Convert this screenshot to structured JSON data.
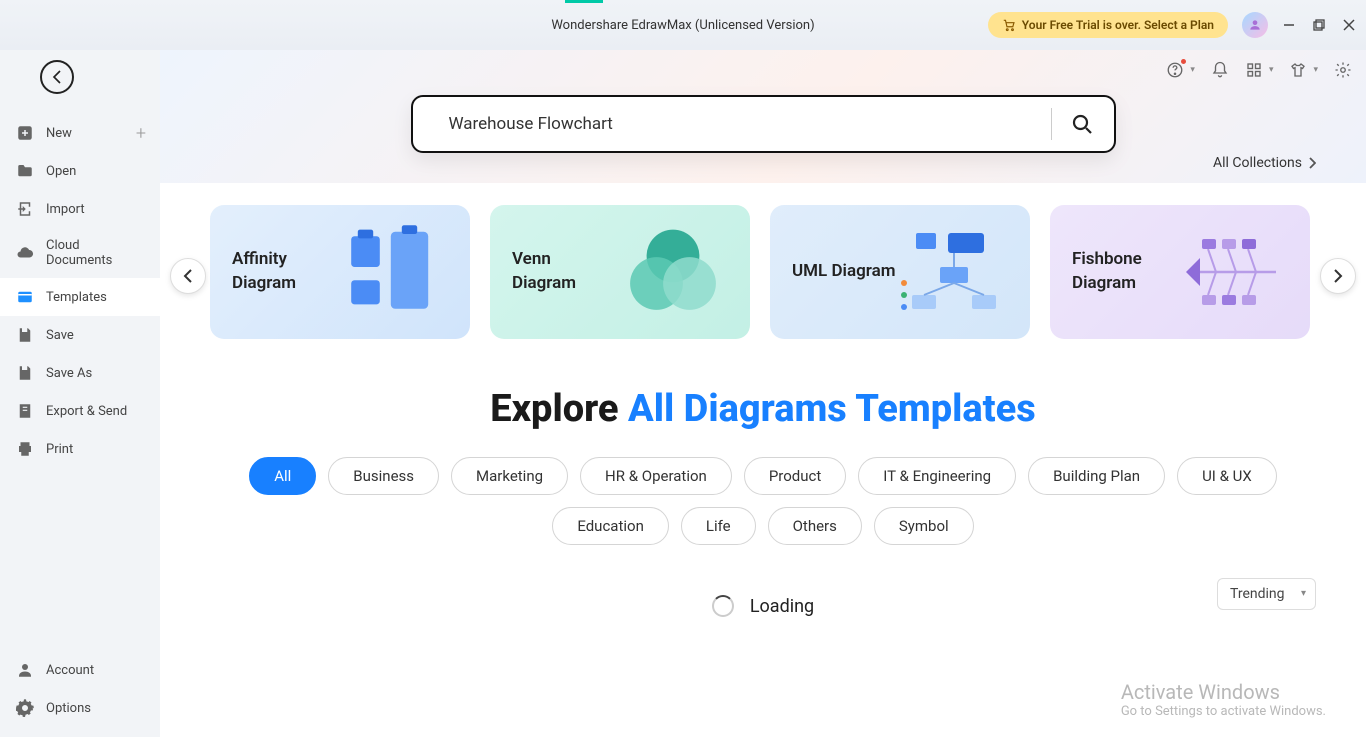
{
  "app": {
    "title": "Wondershare EdrawMax (Unlicensed Version)"
  },
  "trial": {
    "text": "Your Free Trial is over. Select a Plan"
  },
  "sidebar": {
    "items": [
      {
        "label": "New"
      },
      {
        "label": "Open"
      },
      {
        "label": "Import"
      },
      {
        "label": "Cloud Documents"
      },
      {
        "label": "Templates"
      },
      {
        "label": "Save"
      },
      {
        "label": "Save As"
      },
      {
        "label": "Export & Send"
      },
      {
        "label": "Print"
      }
    ],
    "bottom": [
      {
        "label": "Account"
      },
      {
        "label": "Options"
      }
    ]
  },
  "search": {
    "value": "Warehouse Flowchart"
  },
  "all_collections": "All Collections",
  "cards": [
    {
      "label": "Affinity Diagram"
    },
    {
      "label": "Venn Diagram"
    },
    {
      "label": "UML Diagram"
    },
    {
      "label": "Fishbone Diagram"
    }
  ],
  "explore": {
    "prefix": "Explore ",
    "accent": "All Diagrams Templates"
  },
  "chips": [
    "All",
    "Business",
    "Marketing",
    "HR & Operation",
    "Product",
    "IT & Engineering",
    "Building Plan",
    "UI & UX",
    "Education",
    "Life",
    "Others",
    "Symbol"
  ],
  "sort": {
    "value": "Trending"
  },
  "loading": "Loading",
  "watermark": {
    "line1": "Activate Windows",
    "line2": "Go to Settings to activate Windows."
  }
}
